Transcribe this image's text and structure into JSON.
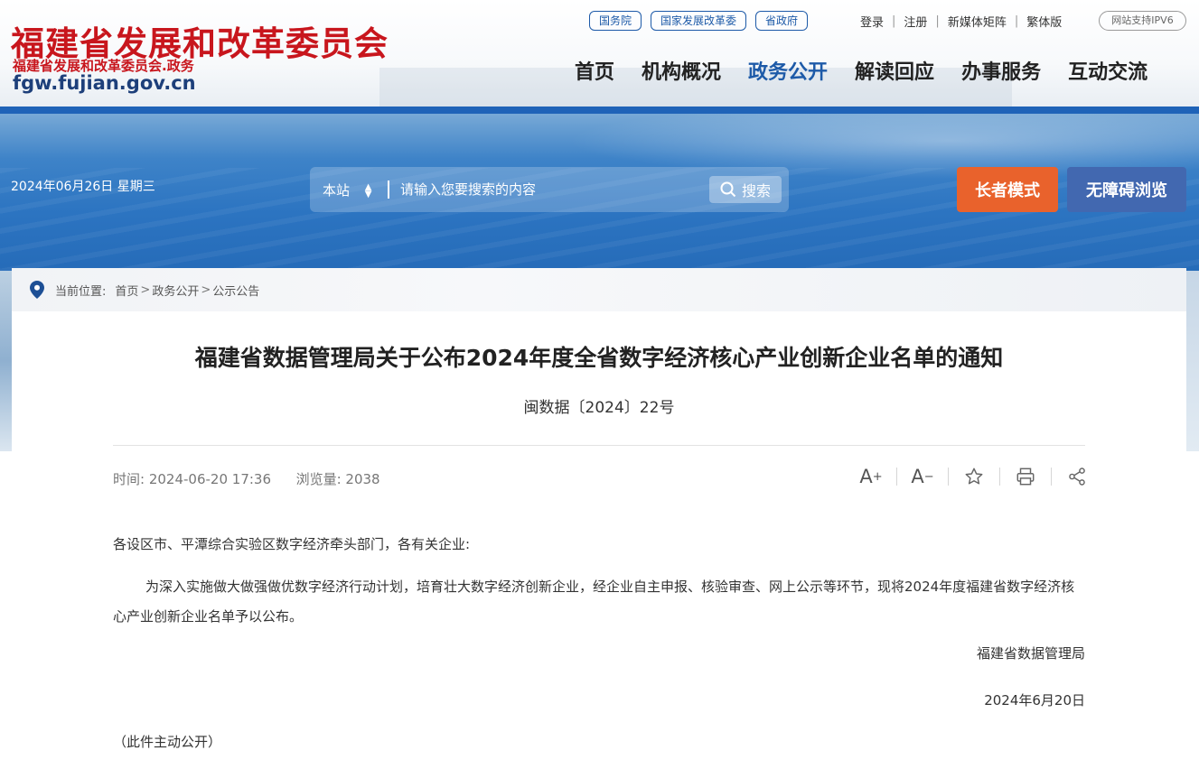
{
  "header": {
    "logo_title": "福建省发展和改革委员会",
    "logo_subtitle": "福建省发展和改革委员会.政务",
    "logo_domain": "fgw.fujian.gov.cn",
    "top_links": [
      "国务院",
      "国家发展改革委",
      "省政府"
    ],
    "user_links": [
      "登录",
      "注册",
      "新媒体矩阵",
      "繁体版"
    ],
    "ipv6": "网站支持IPV6",
    "nav": [
      "首页",
      "机构概况",
      "政务公开",
      "解读回应",
      "办事服务",
      "互动交流"
    ],
    "nav_active": "政务公开"
  },
  "banner": {
    "date": "2024年06月26日 星期三",
    "search_scope": "本站",
    "search_placeholder": "请输入您要搜索的内容",
    "search_button": "搜索",
    "elder_mode": "长者模式",
    "accessible": "无障碍浏览"
  },
  "breadcrumb": {
    "label": "当前位置:",
    "items": [
      "首页",
      "政务公开",
      "公示公告"
    ]
  },
  "article": {
    "title": "福建省数据管理局关于公布2024年度全省数字经济核心产业创新企业名单的通知",
    "doc_number": "闽数据〔2024〕22号",
    "time_label": "时间:",
    "time": "2024-06-20 17:36",
    "views_label": "浏览量:",
    "views": "2038",
    "salutation": "各设区市、平潭综合实验区数字经济牵头部门，各有关企业:",
    "body": "为深入实施做大做强做优数字经济行动计划，培育壮大数字经济创新企业，经企业自主申报、核验审查、网上公示等环节，现将2024年度福建省数字经济核心产业创新企业名单予以公布。",
    "signature_org": "福建省数据管理局",
    "signature_date": "2024年6月20日",
    "note": "（此件主动公开）"
  },
  "colors": {
    "brand_red": "#c8161d",
    "brand_blue": "#1d5aa8",
    "elder_orange": "#e9622c",
    "access_blue": "#4268b0"
  }
}
